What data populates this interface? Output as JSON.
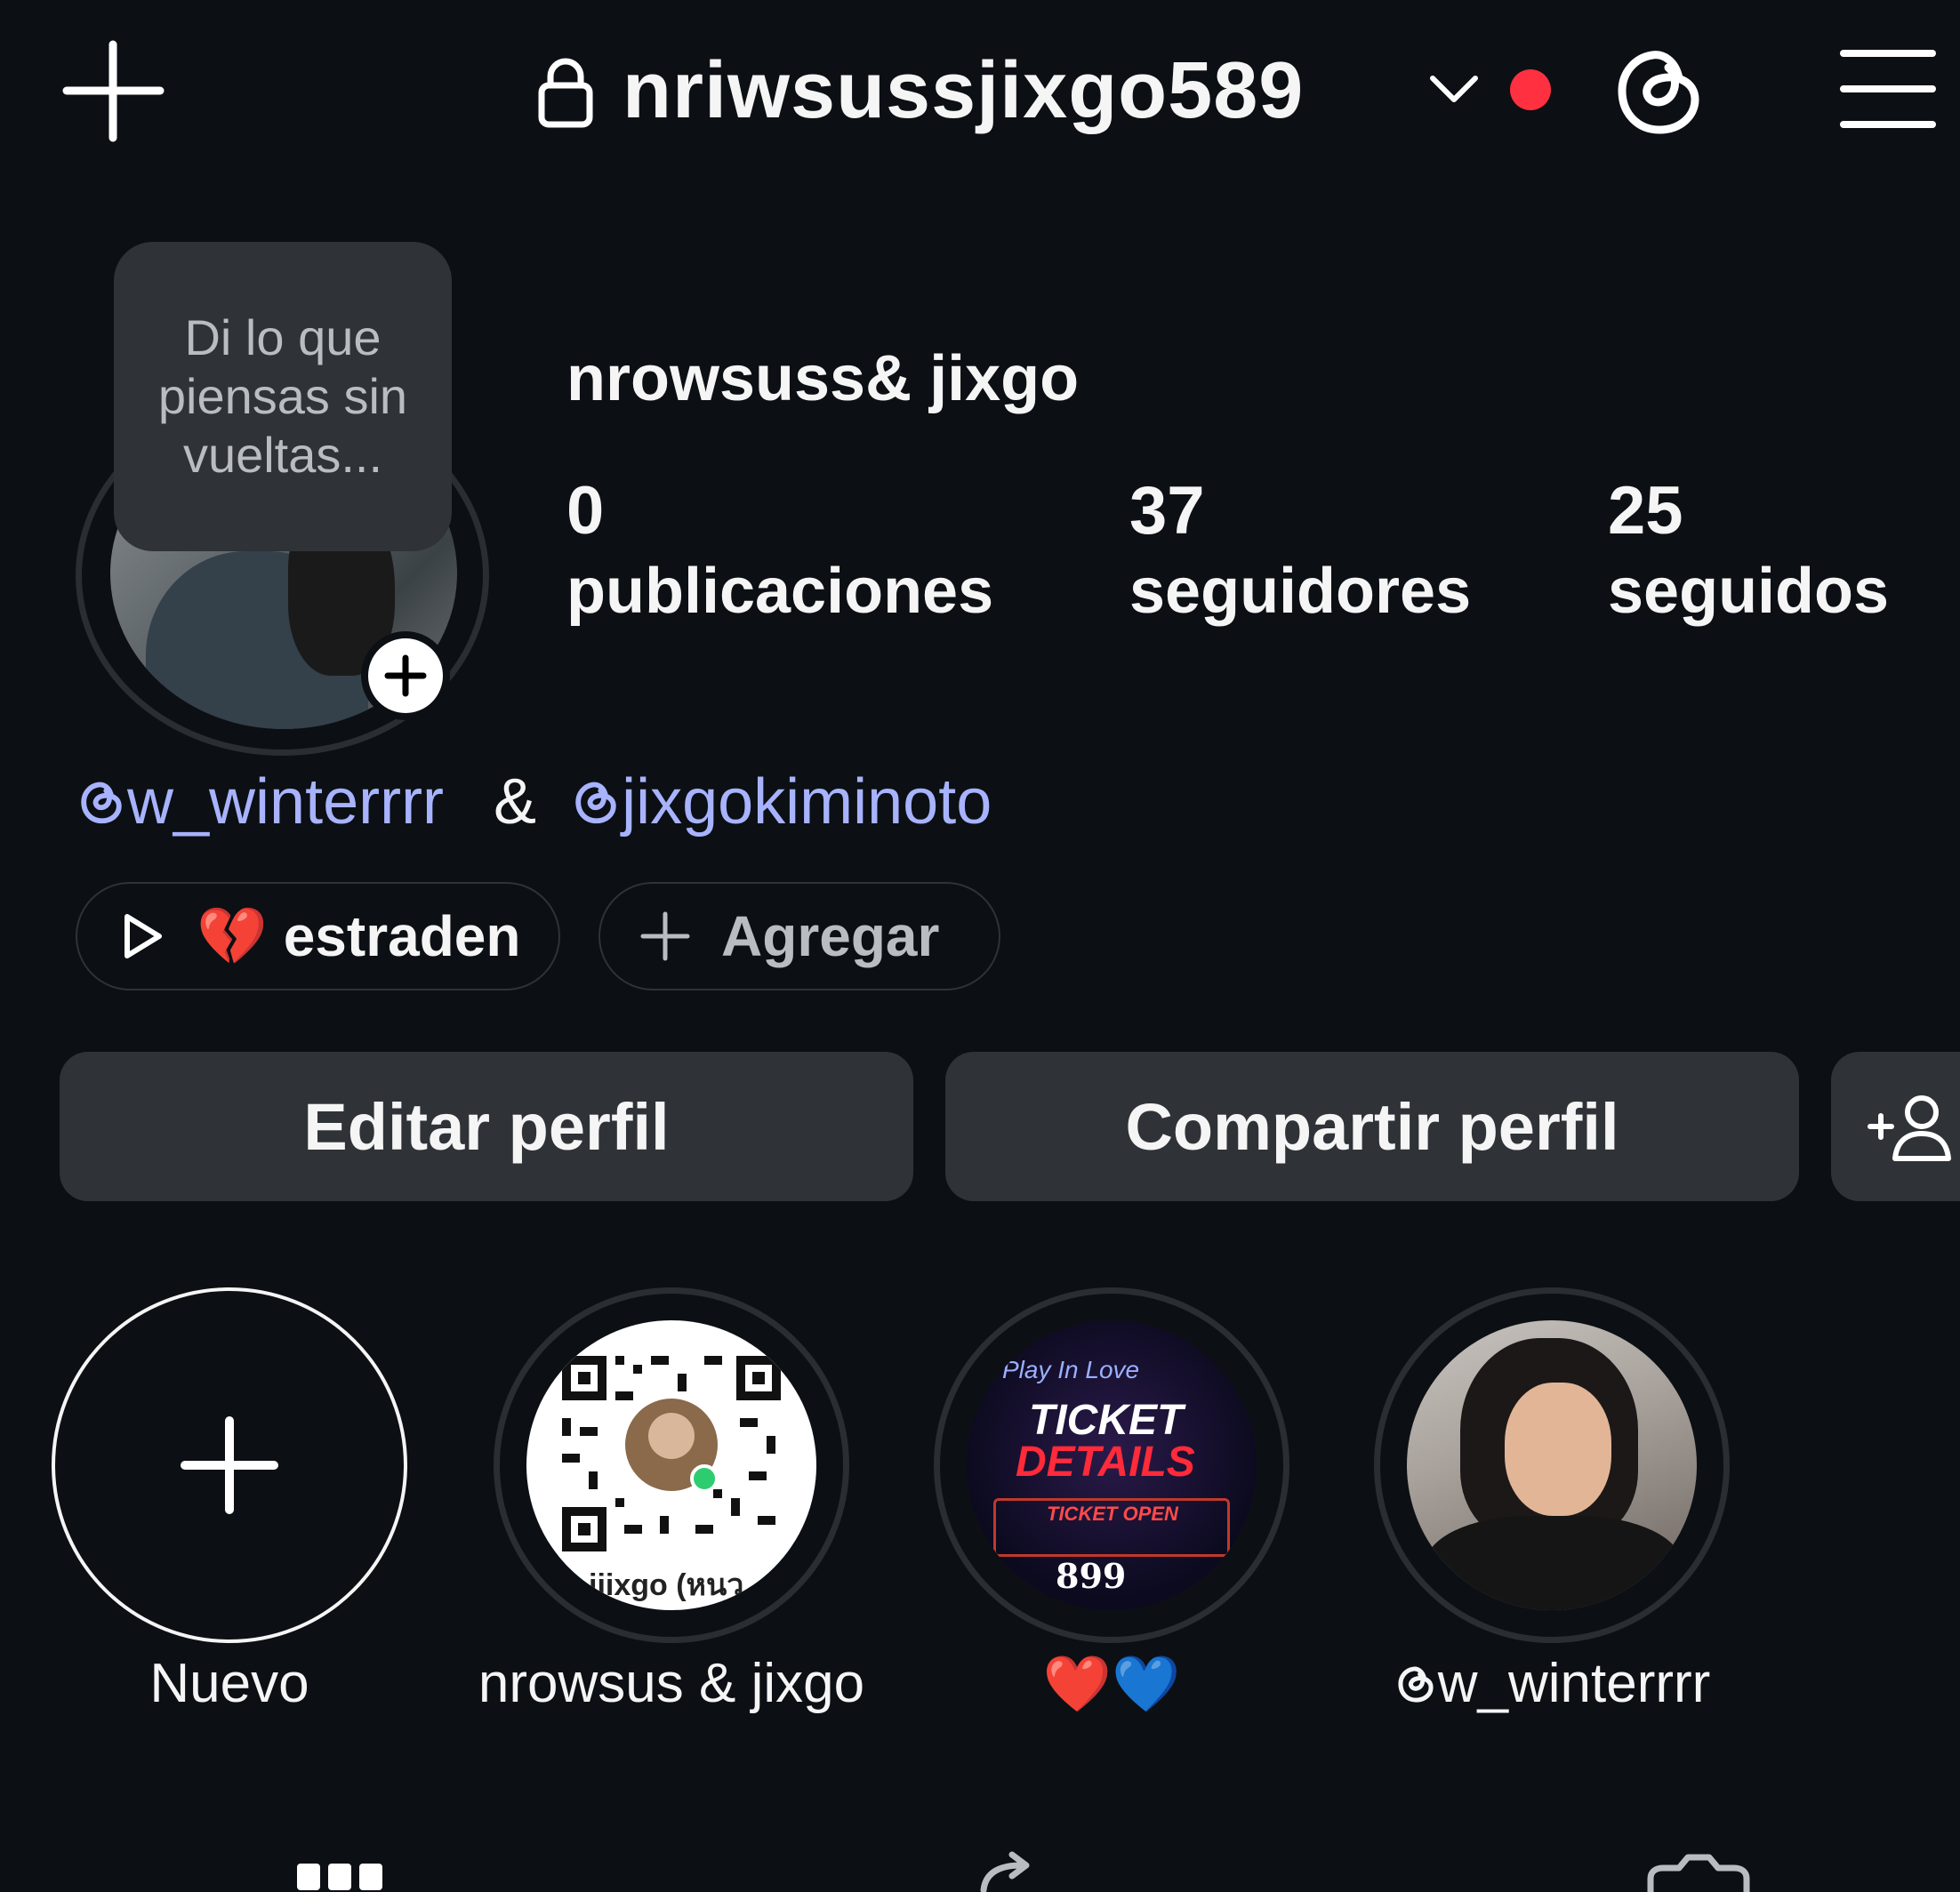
{
  "header": {
    "username": "nriwsussjixgo589",
    "new_icon": "plus-icon",
    "lock_icon": "lock-icon",
    "switch_icon": "chevron-down-icon",
    "notification_color": "#ff3040",
    "threads_icon": "threads-icon",
    "menu_icon": "hamburger-menu-icon"
  },
  "profile": {
    "note": "Di lo que piensas sin vueltas...",
    "display_name": "nrowsuss& jixgo",
    "stats": [
      {
        "count": "0",
        "label": "publicaciones"
      },
      {
        "count": "37",
        "label": "seguidores"
      },
      {
        "count": "25",
        "label": "seguidos"
      }
    ],
    "bio": {
      "mention1": "w_winterrrr",
      "separator": "&",
      "mention2": "jixgokiminoto"
    },
    "mention_color": "#a8b3ff",
    "music_pill": {
      "emoji": "💔",
      "text": "estraden"
    },
    "add_pill": {
      "text": "Agregar"
    }
  },
  "actions": {
    "edit": "Editar perfil",
    "share": "Compartir perfil",
    "add_user_icon": "add-person-icon"
  },
  "highlights": [
    {
      "label": "Nuevo",
      "type": "new"
    },
    {
      "label": "nrowsus & jixgo",
      "type": "qr"
    },
    {
      "label": "❤️💙",
      "type": "ticket",
      "ticket_title": "TICKET",
      "ticket_sub": "DETAILS",
      "ticket_script": "Play In Love",
      "ticket_open": "TICKET OPEN",
      "ticket_price": "899"
    },
    {
      "label": "w_winterrrr",
      "type": "photo"
    }
  ],
  "qr_caption": "jiixgo (หนว",
  "tabs": [
    "grid-icon",
    "reels-icon",
    "tagged-icon"
  ]
}
